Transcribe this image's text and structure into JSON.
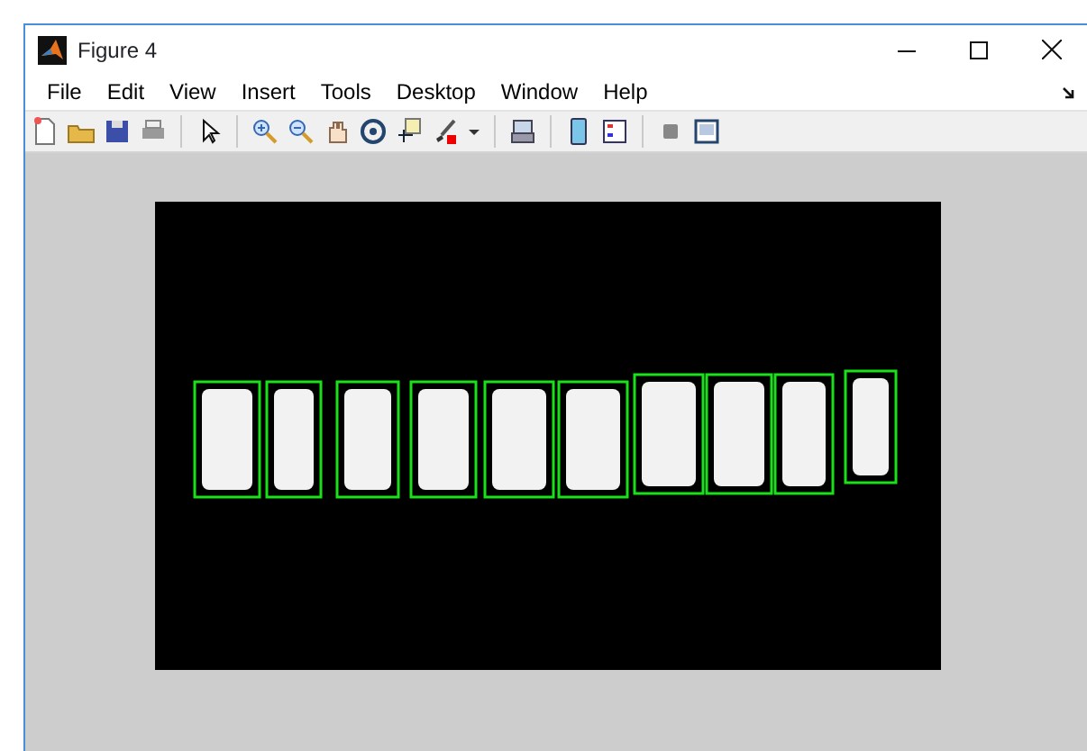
{
  "window": {
    "title": "Figure 4"
  },
  "menu": [
    "File",
    "Edit",
    "View",
    "Insert",
    "Tools",
    "Desktop",
    "Window",
    "Help"
  ]
}
